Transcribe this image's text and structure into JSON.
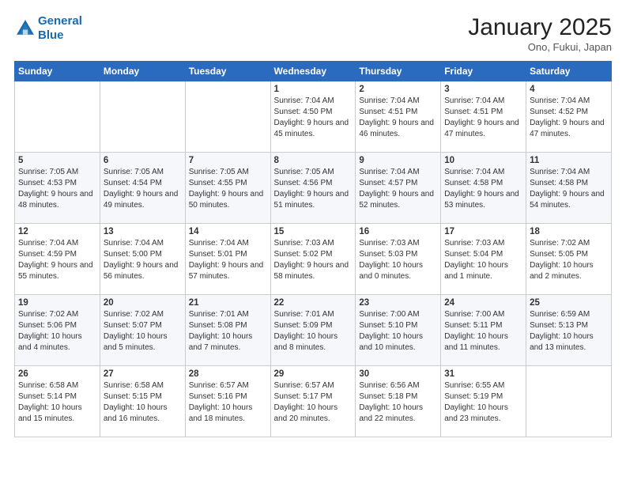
{
  "header": {
    "logo_line1": "General",
    "logo_line2": "Blue",
    "month": "January 2025",
    "location": "Ono, Fukui, Japan"
  },
  "weekdays": [
    "Sunday",
    "Monday",
    "Tuesday",
    "Wednesday",
    "Thursday",
    "Friday",
    "Saturday"
  ],
  "weeks": [
    [
      {
        "day": "",
        "info": ""
      },
      {
        "day": "",
        "info": ""
      },
      {
        "day": "",
        "info": ""
      },
      {
        "day": "1",
        "info": "Sunrise: 7:04 AM\nSunset: 4:50 PM\nDaylight: 9 hours\nand 45 minutes."
      },
      {
        "day": "2",
        "info": "Sunrise: 7:04 AM\nSunset: 4:51 PM\nDaylight: 9 hours\nand 46 minutes."
      },
      {
        "day": "3",
        "info": "Sunrise: 7:04 AM\nSunset: 4:51 PM\nDaylight: 9 hours\nand 47 minutes."
      },
      {
        "day": "4",
        "info": "Sunrise: 7:04 AM\nSunset: 4:52 PM\nDaylight: 9 hours\nand 47 minutes."
      }
    ],
    [
      {
        "day": "5",
        "info": "Sunrise: 7:05 AM\nSunset: 4:53 PM\nDaylight: 9 hours\nand 48 minutes."
      },
      {
        "day": "6",
        "info": "Sunrise: 7:05 AM\nSunset: 4:54 PM\nDaylight: 9 hours\nand 49 minutes."
      },
      {
        "day": "7",
        "info": "Sunrise: 7:05 AM\nSunset: 4:55 PM\nDaylight: 9 hours\nand 50 minutes."
      },
      {
        "day": "8",
        "info": "Sunrise: 7:05 AM\nSunset: 4:56 PM\nDaylight: 9 hours\nand 51 minutes."
      },
      {
        "day": "9",
        "info": "Sunrise: 7:04 AM\nSunset: 4:57 PM\nDaylight: 9 hours\nand 52 minutes."
      },
      {
        "day": "10",
        "info": "Sunrise: 7:04 AM\nSunset: 4:58 PM\nDaylight: 9 hours\nand 53 minutes."
      },
      {
        "day": "11",
        "info": "Sunrise: 7:04 AM\nSunset: 4:58 PM\nDaylight: 9 hours\nand 54 minutes."
      }
    ],
    [
      {
        "day": "12",
        "info": "Sunrise: 7:04 AM\nSunset: 4:59 PM\nDaylight: 9 hours\nand 55 minutes."
      },
      {
        "day": "13",
        "info": "Sunrise: 7:04 AM\nSunset: 5:00 PM\nDaylight: 9 hours\nand 56 minutes."
      },
      {
        "day": "14",
        "info": "Sunrise: 7:04 AM\nSunset: 5:01 PM\nDaylight: 9 hours\nand 57 minutes."
      },
      {
        "day": "15",
        "info": "Sunrise: 7:03 AM\nSunset: 5:02 PM\nDaylight: 9 hours\nand 58 minutes."
      },
      {
        "day": "16",
        "info": "Sunrise: 7:03 AM\nSunset: 5:03 PM\nDaylight: 10 hours\nand 0 minutes."
      },
      {
        "day": "17",
        "info": "Sunrise: 7:03 AM\nSunset: 5:04 PM\nDaylight: 10 hours\nand 1 minute."
      },
      {
        "day": "18",
        "info": "Sunrise: 7:02 AM\nSunset: 5:05 PM\nDaylight: 10 hours\nand 2 minutes."
      }
    ],
    [
      {
        "day": "19",
        "info": "Sunrise: 7:02 AM\nSunset: 5:06 PM\nDaylight: 10 hours\nand 4 minutes."
      },
      {
        "day": "20",
        "info": "Sunrise: 7:02 AM\nSunset: 5:07 PM\nDaylight: 10 hours\nand 5 minutes."
      },
      {
        "day": "21",
        "info": "Sunrise: 7:01 AM\nSunset: 5:08 PM\nDaylight: 10 hours\nand 7 minutes."
      },
      {
        "day": "22",
        "info": "Sunrise: 7:01 AM\nSunset: 5:09 PM\nDaylight: 10 hours\nand 8 minutes."
      },
      {
        "day": "23",
        "info": "Sunrise: 7:00 AM\nSunset: 5:10 PM\nDaylight: 10 hours\nand 10 minutes."
      },
      {
        "day": "24",
        "info": "Sunrise: 7:00 AM\nSunset: 5:11 PM\nDaylight: 10 hours\nand 11 minutes."
      },
      {
        "day": "25",
        "info": "Sunrise: 6:59 AM\nSunset: 5:13 PM\nDaylight: 10 hours\nand 13 minutes."
      }
    ],
    [
      {
        "day": "26",
        "info": "Sunrise: 6:58 AM\nSunset: 5:14 PM\nDaylight: 10 hours\nand 15 minutes."
      },
      {
        "day": "27",
        "info": "Sunrise: 6:58 AM\nSunset: 5:15 PM\nDaylight: 10 hours\nand 16 minutes."
      },
      {
        "day": "28",
        "info": "Sunrise: 6:57 AM\nSunset: 5:16 PM\nDaylight: 10 hours\nand 18 minutes."
      },
      {
        "day": "29",
        "info": "Sunrise: 6:57 AM\nSunset: 5:17 PM\nDaylight: 10 hours\nand 20 minutes."
      },
      {
        "day": "30",
        "info": "Sunrise: 6:56 AM\nSunset: 5:18 PM\nDaylight: 10 hours\nand 22 minutes."
      },
      {
        "day": "31",
        "info": "Sunrise: 6:55 AM\nSunset: 5:19 PM\nDaylight: 10 hours\nand 23 minutes."
      },
      {
        "day": "",
        "info": ""
      }
    ]
  ]
}
